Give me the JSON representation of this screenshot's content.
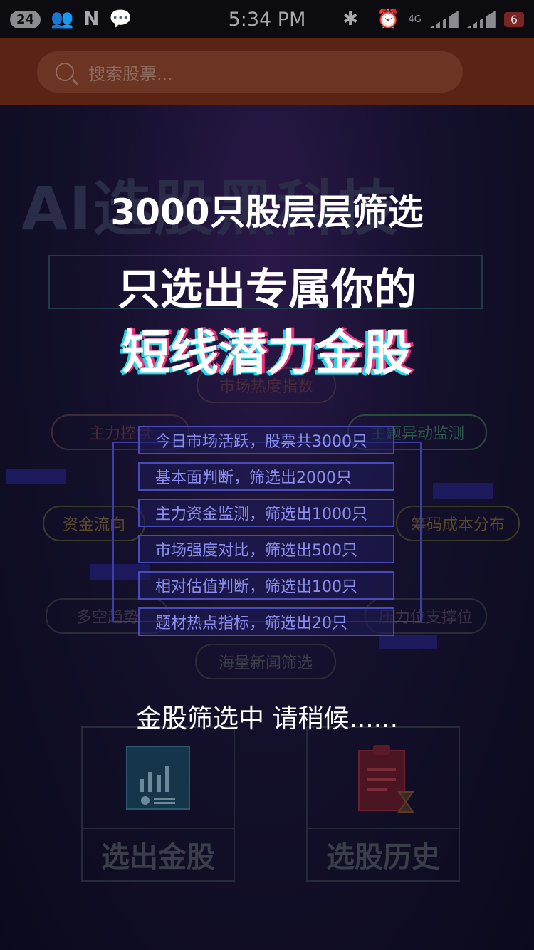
{
  "status_bar": {
    "notif_count": "24",
    "time": "5:34 PM",
    "network": "4G",
    "battery": "6"
  },
  "search": {
    "placeholder": "搜索股票..."
  },
  "overlay": {
    "line1": "3000只股层层筛选",
    "line2": "只选出专属你的",
    "line3": "短线潜力金股",
    "filters": [
      "今日市场活跃，股票共3000只",
      "基本面判断，筛选出2000只",
      "主力资金监测，筛选出1000只",
      "市场强度对比，筛选出500只",
      "相对估值判断，筛选出100只",
      "题材热点指标，筛选出20只"
    ],
    "loading": "金股筛选中 请稍候......"
  },
  "background": {
    "title": "AI选股黑科技",
    "chips": [
      "市场热度指数",
      "主力控盘",
      "主题异动监测",
      "资金流向",
      "筹码成本分布",
      "多空趋势",
      "压力位支撑位",
      "海量新闻筛选"
    ],
    "tiles": [
      "选出金股",
      "选股历史"
    ]
  },
  "colors": {
    "accent_cyan": "#24d6e6",
    "accent_pink": "#e8327e",
    "filter_text": "#8b8ef0",
    "header_bg": "#5a2314"
  }
}
